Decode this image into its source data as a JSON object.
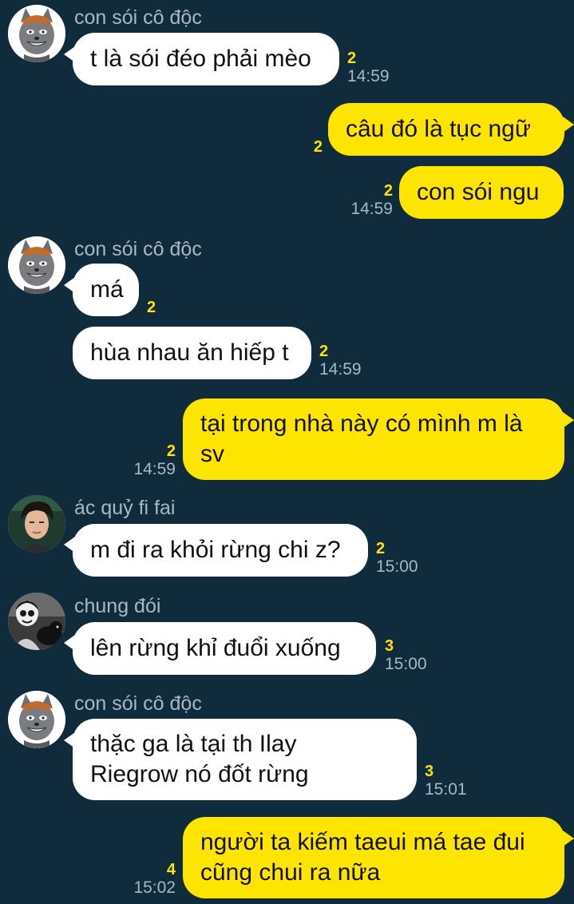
{
  "colors": {
    "background": "#0f2b3c",
    "incoming_bubble": "#ffffff",
    "outgoing_bubble": "#fee500",
    "unread_count": "#fee500",
    "meta_text": "#a9b8c2"
  },
  "messages": [
    {
      "id": "m1",
      "direction": "incoming",
      "sender": "con sói cô độc",
      "avatar_icon": "grey-wolf-cartoon-avatar",
      "text": "t là sói đéo phải mèo",
      "unread": "2",
      "time": "14:59"
    },
    {
      "id": "m2",
      "direction": "outgoing",
      "text": "câu đó là tục ngữ",
      "unread": "2",
      "time": ""
    },
    {
      "id": "m3",
      "direction": "outgoing",
      "text": "con sói ngu",
      "unread": "2",
      "time": "14:59"
    },
    {
      "id": "m4",
      "direction": "incoming",
      "sender": "con sói cô độc",
      "avatar_icon": "grey-wolf-cartoon-avatar",
      "text": "má",
      "unread": "2",
      "time": ""
    },
    {
      "id": "m5",
      "direction": "incoming",
      "text": "hùa nhau ăn hiếp t",
      "unread": "2",
      "time": "14:59"
    },
    {
      "id": "m6",
      "direction": "outgoing",
      "text": "tại trong nhà này có mình m là\nsv",
      "unread": "2",
      "time": "14:59"
    },
    {
      "id": "m7",
      "direction": "incoming",
      "sender": "ác quỷ fi fai",
      "avatar_icon": "person-photo-avatar",
      "text": "m đi ra khỏi rừng chi z?",
      "unread": "2",
      "time": "15:00"
    },
    {
      "id": "m8",
      "direction": "incoming",
      "sender": "chung đói",
      "avatar_icon": "person-with-animal-photo-avatar",
      "text": "lên rừng khỉ đuổi xuống",
      "unread": "3",
      "time": "15:00"
    },
    {
      "id": "m9",
      "direction": "incoming",
      "sender": "con sói cô độc",
      "avatar_icon": "grey-wolf-cartoon-avatar",
      "text": "thặc ga là tại th Ilay\nRiegrow nó đốt rừng",
      "unread": "3",
      "time": "15:01"
    },
    {
      "id": "m10",
      "direction": "outgoing",
      "text": "người ta kiếm taeui má tae đui\ncũng chui ra nữa",
      "unread": "4",
      "time": "15:02"
    }
  ]
}
